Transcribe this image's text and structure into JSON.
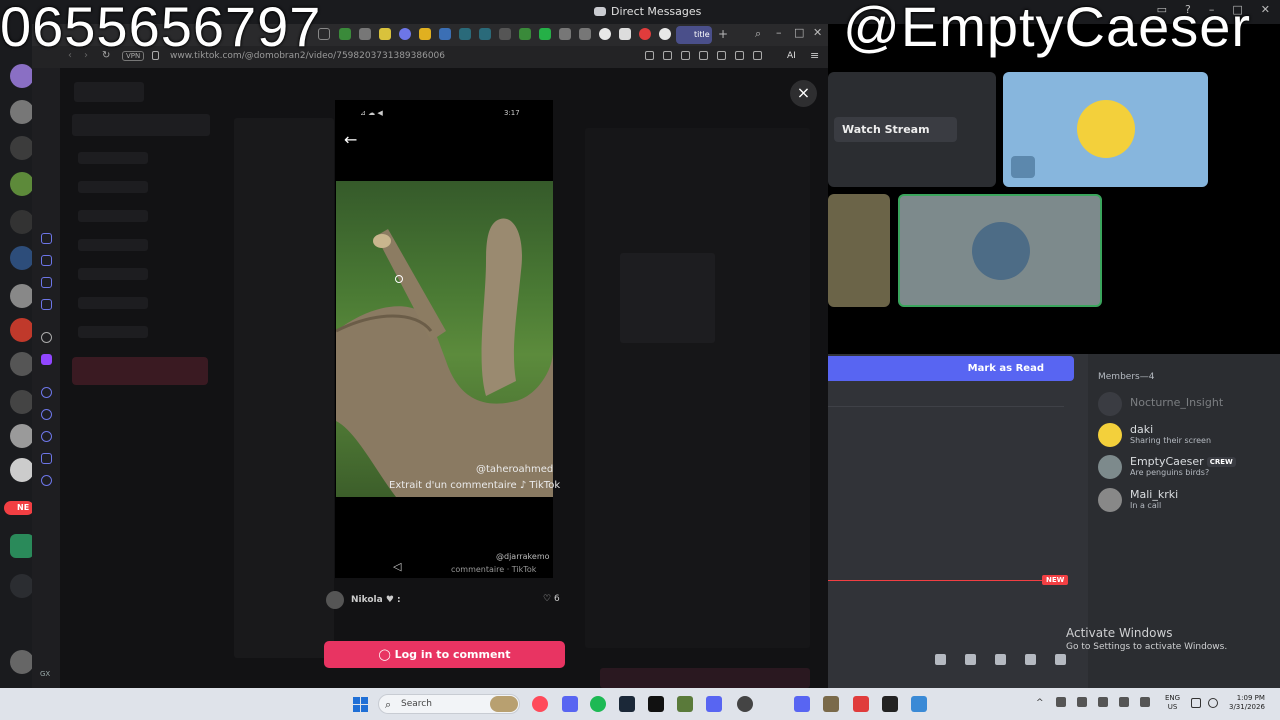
{
  "overlay": {
    "phone_number": "0655656797",
    "handle": "@EmptyCaeser"
  },
  "discord": {
    "window_title": "Direct Messages",
    "watch_stream_label": "Watch Stream",
    "mark_as_read_label": "Mark as Read",
    "new_badge": "NEW",
    "members_title": "Members—4",
    "members": [
      {
        "name": "Nocturne_Insight",
        "status": "",
        "color": "#4e5058"
      },
      {
        "name": "daki",
        "status": "Sharing their screen",
        "color": "#f3d03b"
      },
      {
        "name": "EmptyCaeser",
        "badge": "CREW",
        "status": "Are penguins birds?",
        "color": "#7d8a8c"
      },
      {
        "name": "Mali_krki",
        "status": "In a call",
        "color": "#888888"
      }
    ],
    "side_badge": "NE"
  },
  "browser": {
    "url": "www.tiktok.com/@domobran2/video/7598203731389386006",
    "vpn_label": "VPN",
    "ai_label": "AI",
    "active_tab_label": "title",
    "sidebar_footer": "GX"
  },
  "tiktok": {
    "phone_status_left": "⊿ ☁ ◀",
    "phone_time": "3:17",
    "watermark_handle": "@taheroahmed",
    "watermark_caption": "Extrait d'un commentaire ♪ TikTok",
    "watermark_handle2": "@djarrakemo",
    "watermark_small": "commentaire · TikTok",
    "commenter_name": "Nikola ♥ :",
    "likes_count": "6",
    "login_button_label": "Log in to comment",
    "close_label": "×"
  },
  "windows": {
    "activate_title": "Activate Windows",
    "activate_sub": "Go to Settings to activate Windows.",
    "search_placeholder": "Search",
    "lang_top": "ENG",
    "lang_bottom": "US",
    "time": "1:09 PM",
    "date": "3/31/2026"
  }
}
